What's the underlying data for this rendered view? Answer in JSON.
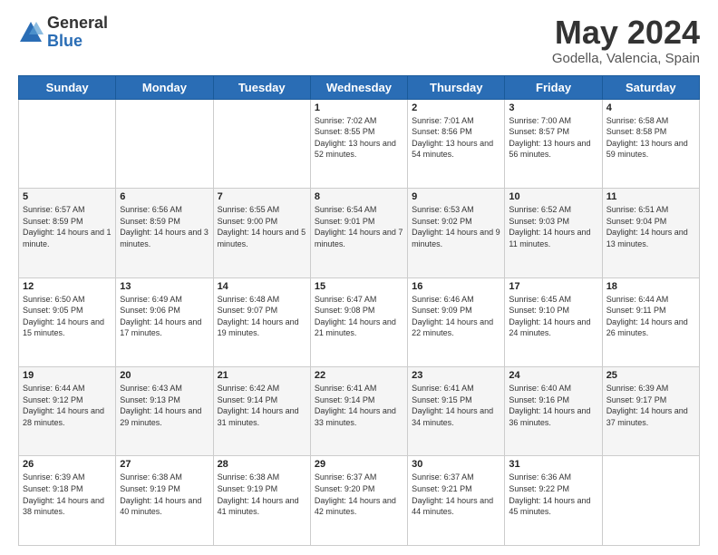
{
  "header": {
    "logo_general": "General",
    "logo_blue": "Blue",
    "month_title": "May 2024",
    "location": "Godella, Valencia, Spain"
  },
  "days_of_week": [
    "Sunday",
    "Monday",
    "Tuesday",
    "Wednesday",
    "Thursday",
    "Friday",
    "Saturday"
  ],
  "weeks": [
    [
      {
        "day": "",
        "sunrise": "",
        "sunset": "",
        "daylight": ""
      },
      {
        "day": "",
        "sunrise": "",
        "sunset": "",
        "daylight": ""
      },
      {
        "day": "",
        "sunrise": "",
        "sunset": "",
        "daylight": ""
      },
      {
        "day": "1",
        "sunrise": "Sunrise: 7:02 AM",
        "sunset": "Sunset: 8:55 PM",
        "daylight": "Daylight: 13 hours and 52 minutes."
      },
      {
        "day": "2",
        "sunrise": "Sunrise: 7:01 AM",
        "sunset": "Sunset: 8:56 PM",
        "daylight": "Daylight: 13 hours and 54 minutes."
      },
      {
        "day": "3",
        "sunrise": "Sunrise: 7:00 AM",
        "sunset": "Sunset: 8:57 PM",
        "daylight": "Daylight: 13 hours and 56 minutes."
      },
      {
        "day": "4",
        "sunrise": "Sunrise: 6:58 AM",
        "sunset": "Sunset: 8:58 PM",
        "daylight": "Daylight: 13 hours and 59 minutes."
      }
    ],
    [
      {
        "day": "5",
        "sunrise": "Sunrise: 6:57 AM",
        "sunset": "Sunset: 8:59 PM",
        "daylight": "Daylight: 14 hours and 1 minute."
      },
      {
        "day": "6",
        "sunrise": "Sunrise: 6:56 AM",
        "sunset": "Sunset: 8:59 PM",
        "daylight": "Daylight: 14 hours and 3 minutes."
      },
      {
        "day": "7",
        "sunrise": "Sunrise: 6:55 AM",
        "sunset": "Sunset: 9:00 PM",
        "daylight": "Daylight: 14 hours and 5 minutes."
      },
      {
        "day": "8",
        "sunrise": "Sunrise: 6:54 AM",
        "sunset": "Sunset: 9:01 PM",
        "daylight": "Daylight: 14 hours and 7 minutes."
      },
      {
        "day": "9",
        "sunrise": "Sunrise: 6:53 AM",
        "sunset": "Sunset: 9:02 PM",
        "daylight": "Daylight: 14 hours and 9 minutes."
      },
      {
        "day": "10",
        "sunrise": "Sunrise: 6:52 AM",
        "sunset": "Sunset: 9:03 PM",
        "daylight": "Daylight: 14 hours and 11 minutes."
      },
      {
        "day": "11",
        "sunrise": "Sunrise: 6:51 AM",
        "sunset": "Sunset: 9:04 PM",
        "daylight": "Daylight: 14 hours and 13 minutes."
      }
    ],
    [
      {
        "day": "12",
        "sunrise": "Sunrise: 6:50 AM",
        "sunset": "Sunset: 9:05 PM",
        "daylight": "Daylight: 14 hours and 15 minutes."
      },
      {
        "day": "13",
        "sunrise": "Sunrise: 6:49 AM",
        "sunset": "Sunset: 9:06 PM",
        "daylight": "Daylight: 14 hours and 17 minutes."
      },
      {
        "day": "14",
        "sunrise": "Sunrise: 6:48 AM",
        "sunset": "Sunset: 9:07 PM",
        "daylight": "Daylight: 14 hours and 19 minutes."
      },
      {
        "day": "15",
        "sunrise": "Sunrise: 6:47 AM",
        "sunset": "Sunset: 9:08 PM",
        "daylight": "Daylight: 14 hours and 21 minutes."
      },
      {
        "day": "16",
        "sunrise": "Sunrise: 6:46 AM",
        "sunset": "Sunset: 9:09 PM",
        "daylight": "Daylight: 14 hours and 22 minutes."
      },
      {
        "day": "17",
        "sunrise": "Sunrise: 6:45 AM",
        "sunset": "Sunset: 9:10 PM",
        "daylight": "Daylight: 14 hours and 24 minutes."
      },
      {
        "day": "18",
        "sunrise": "Sunrise: 6:44 AM",
        "sunset": "Sunset: 9:11 PM",
        "daylight": "Daylight: 14 hours and 26 minutes."
      }
    ],
    [
      {
        "day": "19",
        "sunrise": "Sunrise: 6:44 AM",
        "sunset": "Sunset: 9:12 PM",
        "daylight": "Daylight: 14 hours and 28 minutes."
      },
      {
        "day": "20",
        "sunrise": "Sunrise: 6:43 AM",
        "sunset": "Sunset: 9:13 PM",
        "daylight": "Daylight: 14 hours and 29 minutes."
      },
      {
        "day": "21",
        "sunrise": "Sunrise: 6:42 AM",
        "sunset": "Sunset: 9:14 PM",
        "daylight": "Daylight: 14 hours and 31 minutes."
      },
      {
        "day": "22",
        "sunrise": "Sunrise: 6:41 AM",
        "sunset": "Sunset: 9:14 PM",
        "daylight": "Daylight: 14 hours and 33 minutes."
      },
      {
        "day": "23",
        "sunrise": "Sunrise: 6:41 AM",
        "sunset": "Sunset: 9:15 PM",
        "daylight": "Daylight: 14 hours and 34 minutes."
      },
      {
        "day": "24",
        "sunrise": "Sunrise: 6:40 AM",
        "sunset": "Sunset: 9:16 PM",
        "daylight": "Daylight: 14 hours and 36 minutes."
      },
      {
        "day": "25",
        "sunrise": "Sunrise: 6:39 AM",
        "sunset": "Sunset: 9:17 PM",
        "daylight": "Daylight: 14 hours and 37 minutes."
      }
    ],
    [
      {
        "day": "26",
        "sunrise": "Sunrise: 6:39 AM",
        "sunset": "Sunset: 9:18 PM",
        "daylight": "Daylight: 14 hours and 38 minutes."
      },
      {
        "day": "27",
        "sunrise": "Sunrise: 6:38 AM",
        "sunset": "Sunset: 9:19 PM",
        "daylight": "Daylight: 14 hours and 40 minutes."
      },
      {
        "day": "28",
        "sunrise": "Sunrise: 6:38 AM",
        "sunset": "Sunset: 9:19 PM",
        "daylight": "Daylight: 14 hours and 41 minutes."
      },
      {
        "day": "29",
        "sunrise": "Sunrise: 6:37 AM",
        "sunset": "Sunset: 9:20 PM",
        "daylight": "Daylight: 14 hours and 42 minutes."
      },
      {
        "day": "30",
        "sunrise": "Sunrise: 6:37 AM",
        "sunset": "Sunset: 9:21 PM",
        "daylight": "Daylight: 14 hours and 44 minutes."
      },
      {
        "day": "31",
        "sunrise": "Sunrise: 6:36 AM",
        "sunset": "Sunset: 9:22 PM",
        "daylight": "Daylight: 14 hours and 45 minutes."
      },
      {
        "day": "",
        "sunrise": "",
        "sunset": "",
        "daylight": ""
      }
    ]
  ]
}
